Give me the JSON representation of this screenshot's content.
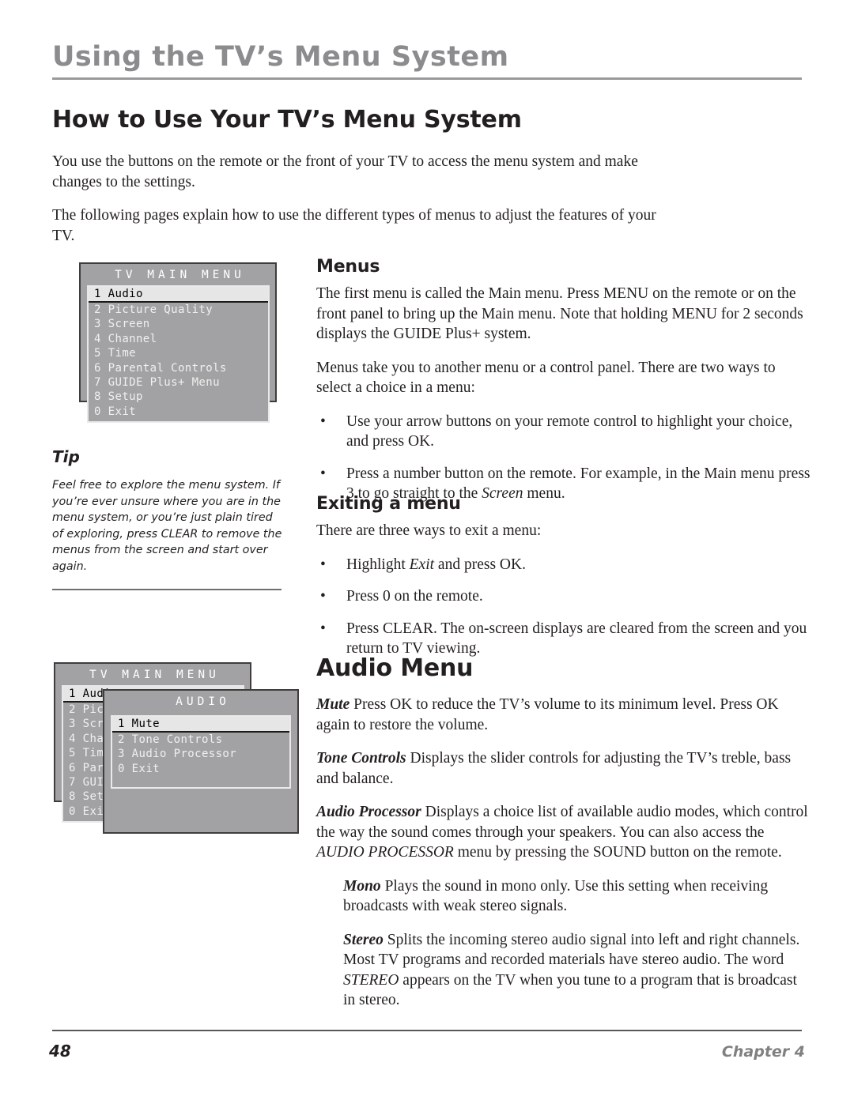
{
  "running_head": {
    "title": "Using the TV’s Menu System"
  },
  "page_heading": "How to Use Your TV’s Menu System",
  "intro": {
    "paragraph_1": "You use the buttons on the remote or the front of your TV to access the menu system and make changes to the settings.",
    "paragraph_2": "The following pages explain how to use the different types of menus to adjust the features of your TV."
  },
  "menus_section": {
    "heading": "Menus",
    "paragraph_1": "The first menu is called the Main menu. Press MENU on the remote or on the front panel to bring up the Main menu. Note that holding MENU for 2 seconds displays the GUIDE Plus+ system.",
    "paragraph_2": "Menus take you to another menu or a control panel. There are two ways to select a choice in a menu:",
    "bullet_1": "Use your arrow buttons on your remote control to highlight your choice, and press OK.",
    "bullet_2_pre": "Press a number button on the remote. For example, in the Main menu press 3 to go straight to the ",
    "bullet_2_italic": "Screen",
    "bullet_2_post": " menu.",
    "bullet_marker": "•"
  },
  "exiting_section": {
    "heading": "Exiting a menu",
    "paragraph_1": "There are three ways to exit a menu:",
    "bullet_1_pre": "Highlight ",
    "bullet_1_italic": "Exit",
    "bullet_1_post": " and press OK.",
    "bullet_2": "Press 0 on the remote.",
    "bullet_3": "Press CLEAR. The on-screen displays are cleared from the screen and you return to TV viewing."
  },
  "audio_section": {
    "heading": "Audio Menu",
    "mute_term": "Mute",
    "mute_text": "  Press OK to reduce the TV’s volume to its minimum level. Press OK again to restore the volume.",
    "tone_term": "Tone Controls",
    "tone_text": "   Displays the slider controls for adjusting the TV’s treble, bass and balance.",
    "processor_term": "Audio Processor",
    "processor_text_pre": "   Displays a choice list of available audio modes, which control the way the sound comes through your speakers. You can also access the ",
    "processor_text_italic": "AUDIO PROCESSOR",
    "processor_text_post": " menu by pressing the SOUND button on the remote.",
    "mono_term": "Mono",
    "mono_text": "   Plays the sound in mono only. Use this setting when receiving broadcasts with weak stereo signals.",
    "stereo_term": "Stereo",
    "stereo_text_pre": "   Splits the incoming stereo audio signal into left and right channels. Most TV programs and recorded materials have stereo audio. The word ",
    "stereo_text_italic": "STEREO",
    "stereo_text_post": " appears on the TV when you tune to a program that is broadcast in stereo."
  },
  "tip": {
    "title": "Tip",
    "body": "Feel free to explore the menu system. If you’re ever unsure where you are in the menu system, or you’re just plain tired of exploring, press CLEAR to remove the menus from the screen and start over again."
  },
  "osd_main_menu": {
    "title": "TV MAIN MENU",
    "items": [
      {
        "label": "1 Audio",
        "selected": true
      },
      {
        "label": "2 Picture Quality",
        "selected": false
      },
      {
        "label": "3 Screen",
        "selected": false
      },
      {
        "label": "4 Channel",
        "selected": false
      },
      {
        "label": "5 Time",
        "selected": false
      },
      {
        "label": "6 Parental Controls",
        "selected": false
      },
      {
        "label": "7 GUIDE Plus+ Menu",
        "selected": false
      },
      {
        "label": "8 Setup",
        "selected": false
      },
      {
        "label": "0 Exit",
        "selected": false
      }
    ]
  },
  "osd_audio_menu": {
    "title": "AUDIO",
    "items": [
      {
        "label": "1 Mute",
        "selected": true
      },
      {
        "label": "2 Tone Controls",
        "selected": false
      },
      {
        "label": "3 Audio Processor",
        "selected": false
      },
      {
        "label": "0 Exit",
        "selected": false
      }
    ]
  },
  "footer": {
    "page_number": "48",
    "chapter": "Chapter 4"
  },
  "colors": {
    "running_head_gray": "#8c8c8e",
    "osd_panel_gray": "#a2a2a4",
    "osd_highlight": "#e6e6e6",
    "body_text": "#231f20",
    "chapter_gray": "#808082"
  }
}
